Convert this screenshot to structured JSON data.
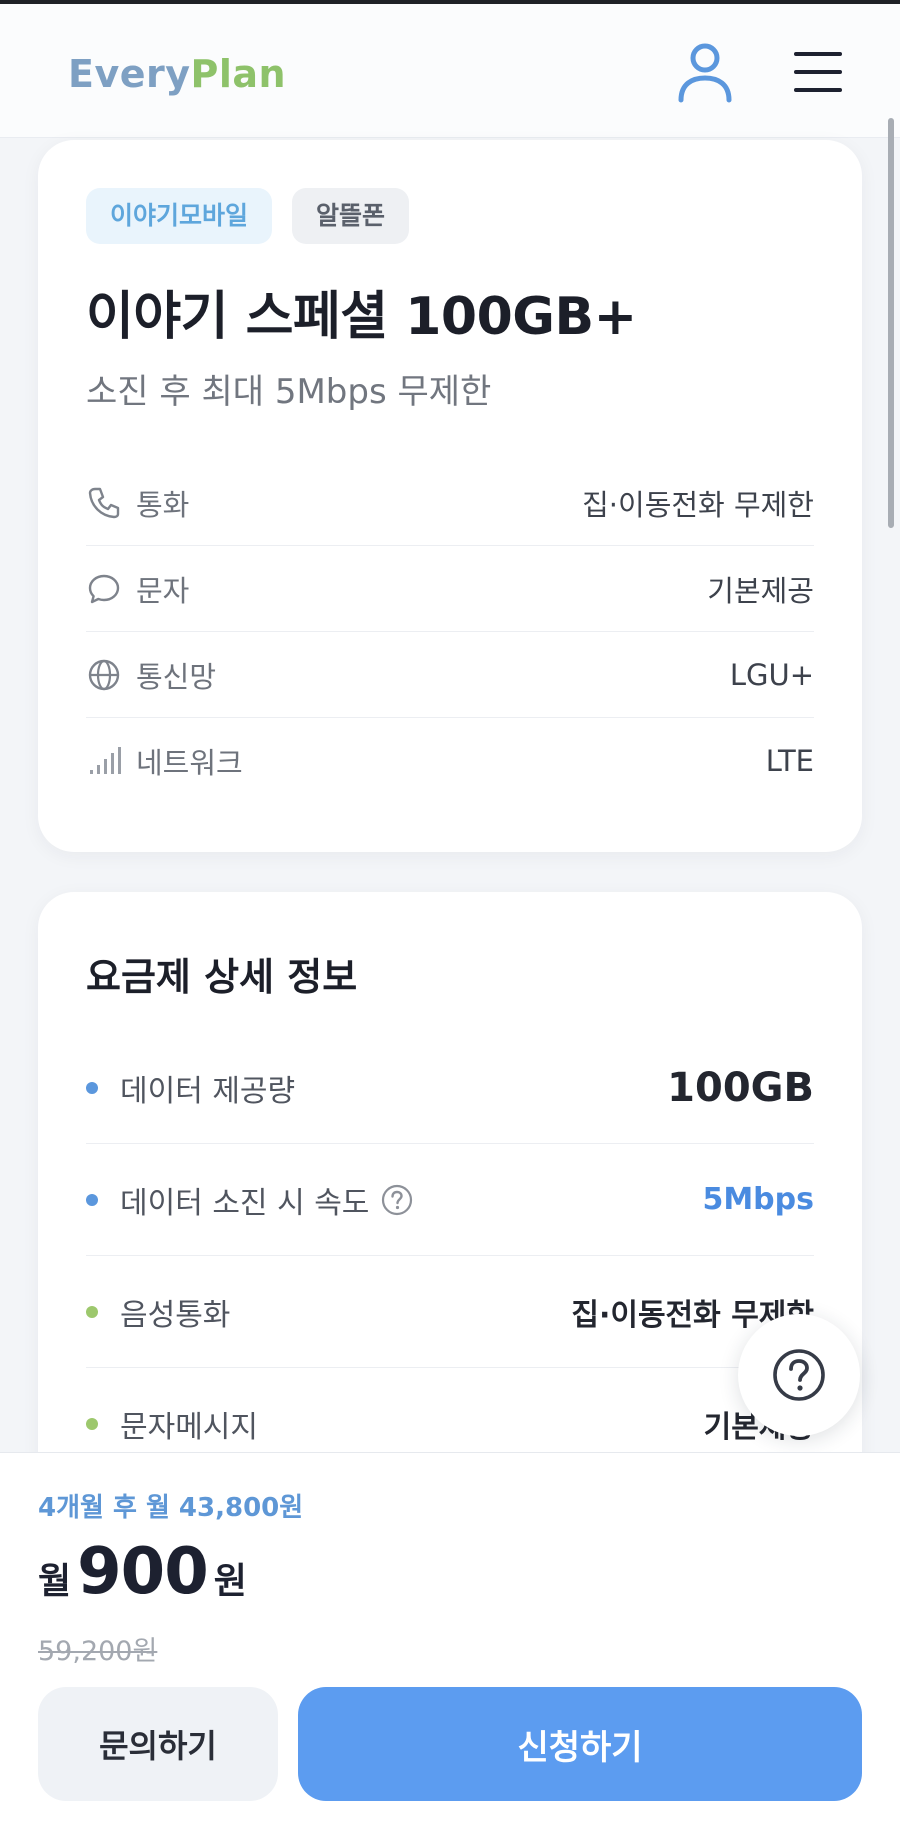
{
  "header": {
    "logo_part1": "Every",
    "logo_part2": "Plan"
  },
  "plan": {
    "carrier_badge": "이야기모바일",
    "type_badge": "알뜰폰",
    "title": "이야기 스페셜 100GB+",
    "subtitle": "소진 후 최대 5Mbps 무제한",
    "specs": [
      {
        "icon": "phone-icon",
        "label": "통화",
        "value": "집·이동전화 무제한"
      },
      {
        "icon": "chat-bubble-icon",
        "label": "문자",
        "value": "기본제공"
      },
      {
        "icon": "globe-icon",
        "label": "통신망",
        "value": "LGU+"
      },
      {
        "icon": "signal-bars-icon",
        "label": "네트워크",
        "value": "LTE"
      }
    ]
  },
  "details": {
    "title": "요금제 상세 정보",
    "rows": [
      {
        "label": "데이터 제공량",
        "value": "100GB",
        "dot": "blue"
      },
      {
        "label": "데이터 소진 시 속도",
        "value": "5Mbps",
        "dot": "blue",
        "help_icon": "question-circle-icon"
      },
      {
        "label": "음성통화",
        "value": "집·이동전화 무제한",
        "dot": "green"
      },
      {
        "label": "문자메시지",
        "value": "기본제공",
        "dot": "green"
      }
    ]
  },
  "footer": {
    "promo_text": "4개월 후 월 43,800원",
    "price_unit": "월",
    "price": "900",
    "price_currency": "원",
    "original_price": "59,200원",
    "inquiry_label": "문의하기",
    "apply_label": "신청하기"
  },
  "colors": {
    "accent": "#5c9cf0",
    "logo_blue": "#7ea0c3",
    "logo_green": "#8ec26a",
    "dot_blue": "#5b97dd",
    "dot_green": "#9dc86d"
  },
  "icons": {
    "user": "user-icon",
    "menu": "hamburger-menu-icon",
    "help": "question-circle-icon"
  }
}
